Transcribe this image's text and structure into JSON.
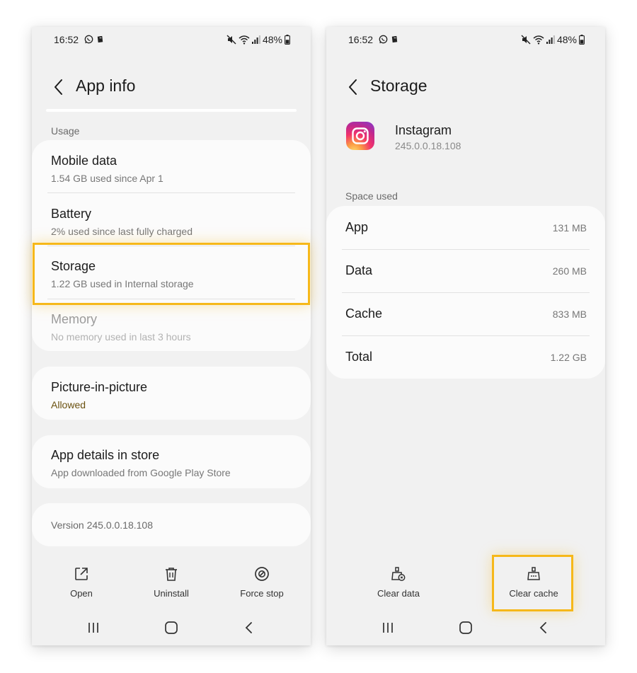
{
  "left_screen": {
    "status": {
      "time": "16:52",
      "battery": "48%"
    },
    "title": "App info",
    "usage_label": "Usage",
    "usage_items": [
      {
        "title": "Mobile data",
        "subtitle": "1.54 GB used since Apr 1"
      },
      {
        "title": "Battery",
        "subtitle": "2% used since last fully charged"
      },
      {
        "title": "Storage",
        "subtitle": "1.22 GB used in Internal storage"
      },
      {
        "title": "Memory",
        "subtitle": "No memory used in last 3 hours"
      }
    ],
    "pip": {
      "title": "Picture-in-picture",
      "subtitle": "Allowed"
    },
    "store": {
      "title": "App details in store",
      "subtitle": "App downloaded from Google Play Store"
    },
    "version": "Version 245.0.0.18.108",
    "actions": [
      {
        "label": "Open",
        "icon": "open-external-icon"
      },
      {
        "label": "Uninstall",
        "icon": "trash-icon"
      },
      {
        "label": "Force stop",
        "icon": "force-stop-icon"
      }
    ]
  },
  "right_screen": {
    "status": {
      "time": "16:52",
      "battery": "48%"
    },
    "title": "Storage",
    "app": {
      "name": "Instagram",
      "version": "245.0.0.18.108",
      "icon": "instagram-icon"
    },
    "space_label": "Space used",
    "space_rows": [
      {
        "label": "App",
        "value": "131 MB"
      },
      {
        "label": "Data",
        "value": "260 MB"
      },
      {
        "label": "Cache",
        "value": "833 MB"
      },
      {
        "label": "Total",
        "value": "1.22 GB"
      }
    ],
    "actions": [
      {
        "label": "Clear data",
        "icon": "clear-data-icon"
      },
      {
        "label": "Clear cache",
        "icon": "clear-cache-icon"
      }
    ]
  },
  "colors": {
    "highlight": "#f6b81a",
    "background": "#f1f1f1",
    "card": "#fbfbfb"
  }
}
